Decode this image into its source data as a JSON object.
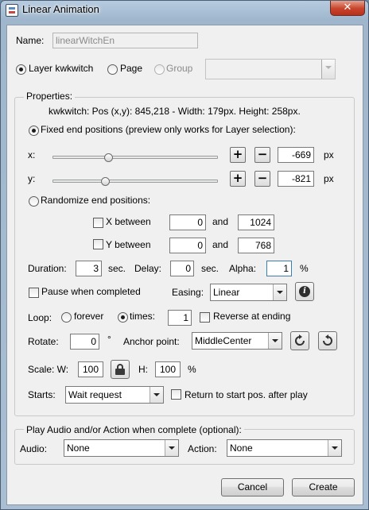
{
  "window": {
    "title": "Linear Animation",
    "close_glyph": "✕"
  },
  "name_field": {
    "label": "Name:",
    "value": "linearWitchEn"
  },
  "target": {
    "layer_label": "Layer kwkwitch",
    "page_label": "Page",
    "group_label": "Group",
    "group_select_value": ""
  },
  "properties": {
    "title": "Properties:",
    "info": "kwkwitch: Pos (x,y): 845,218 - Width: 179px. Height: 258px.",
    "fixed_label": "Fixed end positions (preview only works for Layer selection):",
    "x_label": "x:",
    "x_value": "-669",
    "x_unit": "px",
    "y_label": "y:",
    "y_value": "-821",
    "y_unit": "px",
    "plus_glyph": "+",
    "minus_glyph": "−",
    "randomize_label": "Randomize end positions:",
    "x_between_label": "X between",
    "x_between_min": "0",
    "x_between_max": "1024",
    "y_between_label": "Y between",
    "y_between_min": "0",
    "y_between_max": "768",
    "and_label": "and",
    "duration_label": "Duration:",
    "duration_value": "3",
    "duration_unit": "sec.",
    "delay_label": "Delay:",
    "delay_value": "0",
    "delay_unit": "sec.",
    "alpha_label": "Alpha:",
    "alpha_value": "1",
    "alpha_unit": "%",
    "pause_label": "Pause when completed",
    "easing_label": "Easing:",
    "easing_value": "Linear",
    "loop_label": "Loop:",
    "forever_label": "forever",
    "times_label": "times:",
    "times_value": "1",
    "reverse_label": "Reverse at ending",
    "rotate_label": "Rotate:",
    "rotate_value": "0",
    "rotate_unit": "°",
    "anchor_label": "Anchor point:",
    "anchor_value": "MiddleCenter",
    "scale_label": "Scale: W:",
    "scale_w_value": "100",
    "scale_h_label": "H:",
    "scale_h_value": "100",
    "scale_unit": "%",
    "starts_label": "Starts:",
    "starts_value": "Wait request",
    "return_label": "Return to start pos. after play"
  },
  "play": {
    "title": "Play Audio and/or Action when complete (optional):",
    "audio_label": "Audio:",
    "audio_value": "None",
    "action_label": "Action:",
    "action_value": "None"
  },
  "buttons": {
    "cancel": "Cancel",
    "create": "Create"
  }
}
